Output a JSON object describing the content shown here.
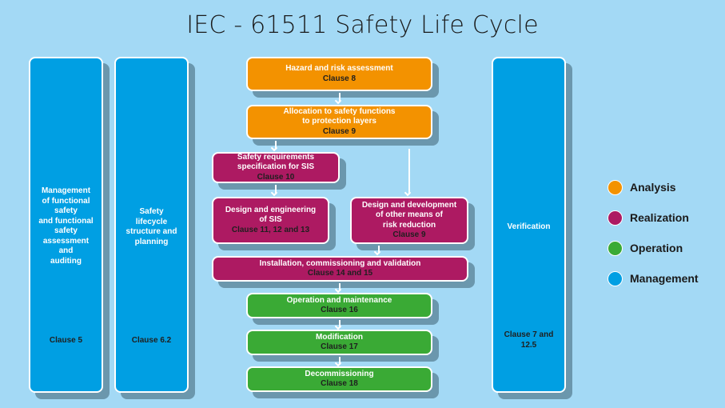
{
  "title": "IEC - 61511 Safety Life Cycle",
  "colors": {
    "analysis": "#f39200",
    "realization": "#ad1a62",
    "operation": "#3aaa35",
    "management": "#009fe3",
    "background": "#a3d9f5"
  },
  "columns": {
    "management": {
      "text": [
        "Management",
        "of functional",
        "safety",
        "and functional",
        "safety",
        "assessment",
        "and",
        "auditing"
      ],
      "clause": "Clause 5"
    },
    "planning": {
      "text": [
        "Safety",
        "lifecycle",
        "structure and",
        "planning"
      ],
      "clause": "Clause 6.2"
    },
    "verification": {
      "text": [
        "Verification"
      ],
      "clause": [
        "Clause 7 and",
        "12.5"
      ]
    }
  },
  "steps": {
    "hazard": {
      "lines": [
        "Hazard and risk assessment"
      ],
      "clause": "Clause 8",
      "category": "Analysis"
    },
    "allocation": {
      "lines": [
        "Allocation to safety functions",
        "to protection layers"
      ],
      "clause": "Clause 9",
      "category": "Analysis"
    },
    "srs": {
      "lines": [
        "Safety requirements",
        "specification for SIS"
      ],
      "clause": "Clause 10",
      "category": "Realization"
    },
    "design_sis": {
      "lines": [
        "Design and engineering",
        "of SIS"
      ],
      "clause": "Clause 11, 12 and 13",
      "category": "Realization"
    },
    "design_other": {
      "lines": [
        "Design and development",
        "of other means of",
        "risk reduction"
      ],
      "clause": "Clause 9",
      "category": "Realization"
    },
    "installation": {
      "lines": [
        "Installation, commissioning and validation"
      ],
      "clause": "Clause 14 and 15",
      "category": "Realization"
    },
    "operation": {
      "lines": [
        "Operation and maintenance"
      ],
      "clause": "Clause 16",
      "category": "Operation"
    },
    "modification": {
      "lines": [
        "Modification"
      ],
      "clause": "Clause 17",
      "category": "Operation"
    },
    "decommissioning": {
      "lines": [
        "Decommissioning"
      ],
      "clause": "Clause 18",
      "category": "Operation"
    }
  },
  "legend": [
    {
      "label": "Analysis",
      "color": "#f39200"
    },
    {
      "label": "Realization",
      "color": "#ad1a62"
    },
    {
      "label": "Operation",
      "color": "#3aaa35"
    },
    {
      "label": "Management",
      "color": "#009fe3"
    }
  ]
}
